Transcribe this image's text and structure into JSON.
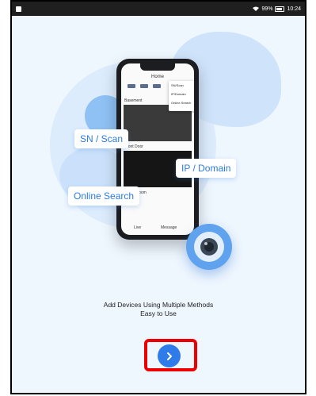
{
  "status_bar": {
    "battery_percent": "99%",
    "time": "10:24"
  },
  "phone_mock": {
    "home_title": "Home",
    "sn_scan_menu": "SN/Scan",
    "ip_domain_menu": "IP/Domain",
    "online_search_menu": "Online Search",
    "room_label_1": "Basement",
    "room_label_2": "Front Door",
    "room_label_3": "Living Room",
    "nav_label_1": "Live",
    "nav_label_2": "Message"
  },
  "methods": {
    "sn_scan": "SN / Scan",
    "ip_domain": "IP / Domain",
    "online_search": "Online Search"
  },
  "caption": {
    "line1": "Add Devices Using Multiple Methods",
    "line2": "Easy to Use"
  },
  "next_button": {
    "icon": "chevron-right-icon"
  },
  "colors": {
    "accent": "#2f7bea",
    "highlight": "#ee0000",
    "background": "#eef6fe"
  }
}
